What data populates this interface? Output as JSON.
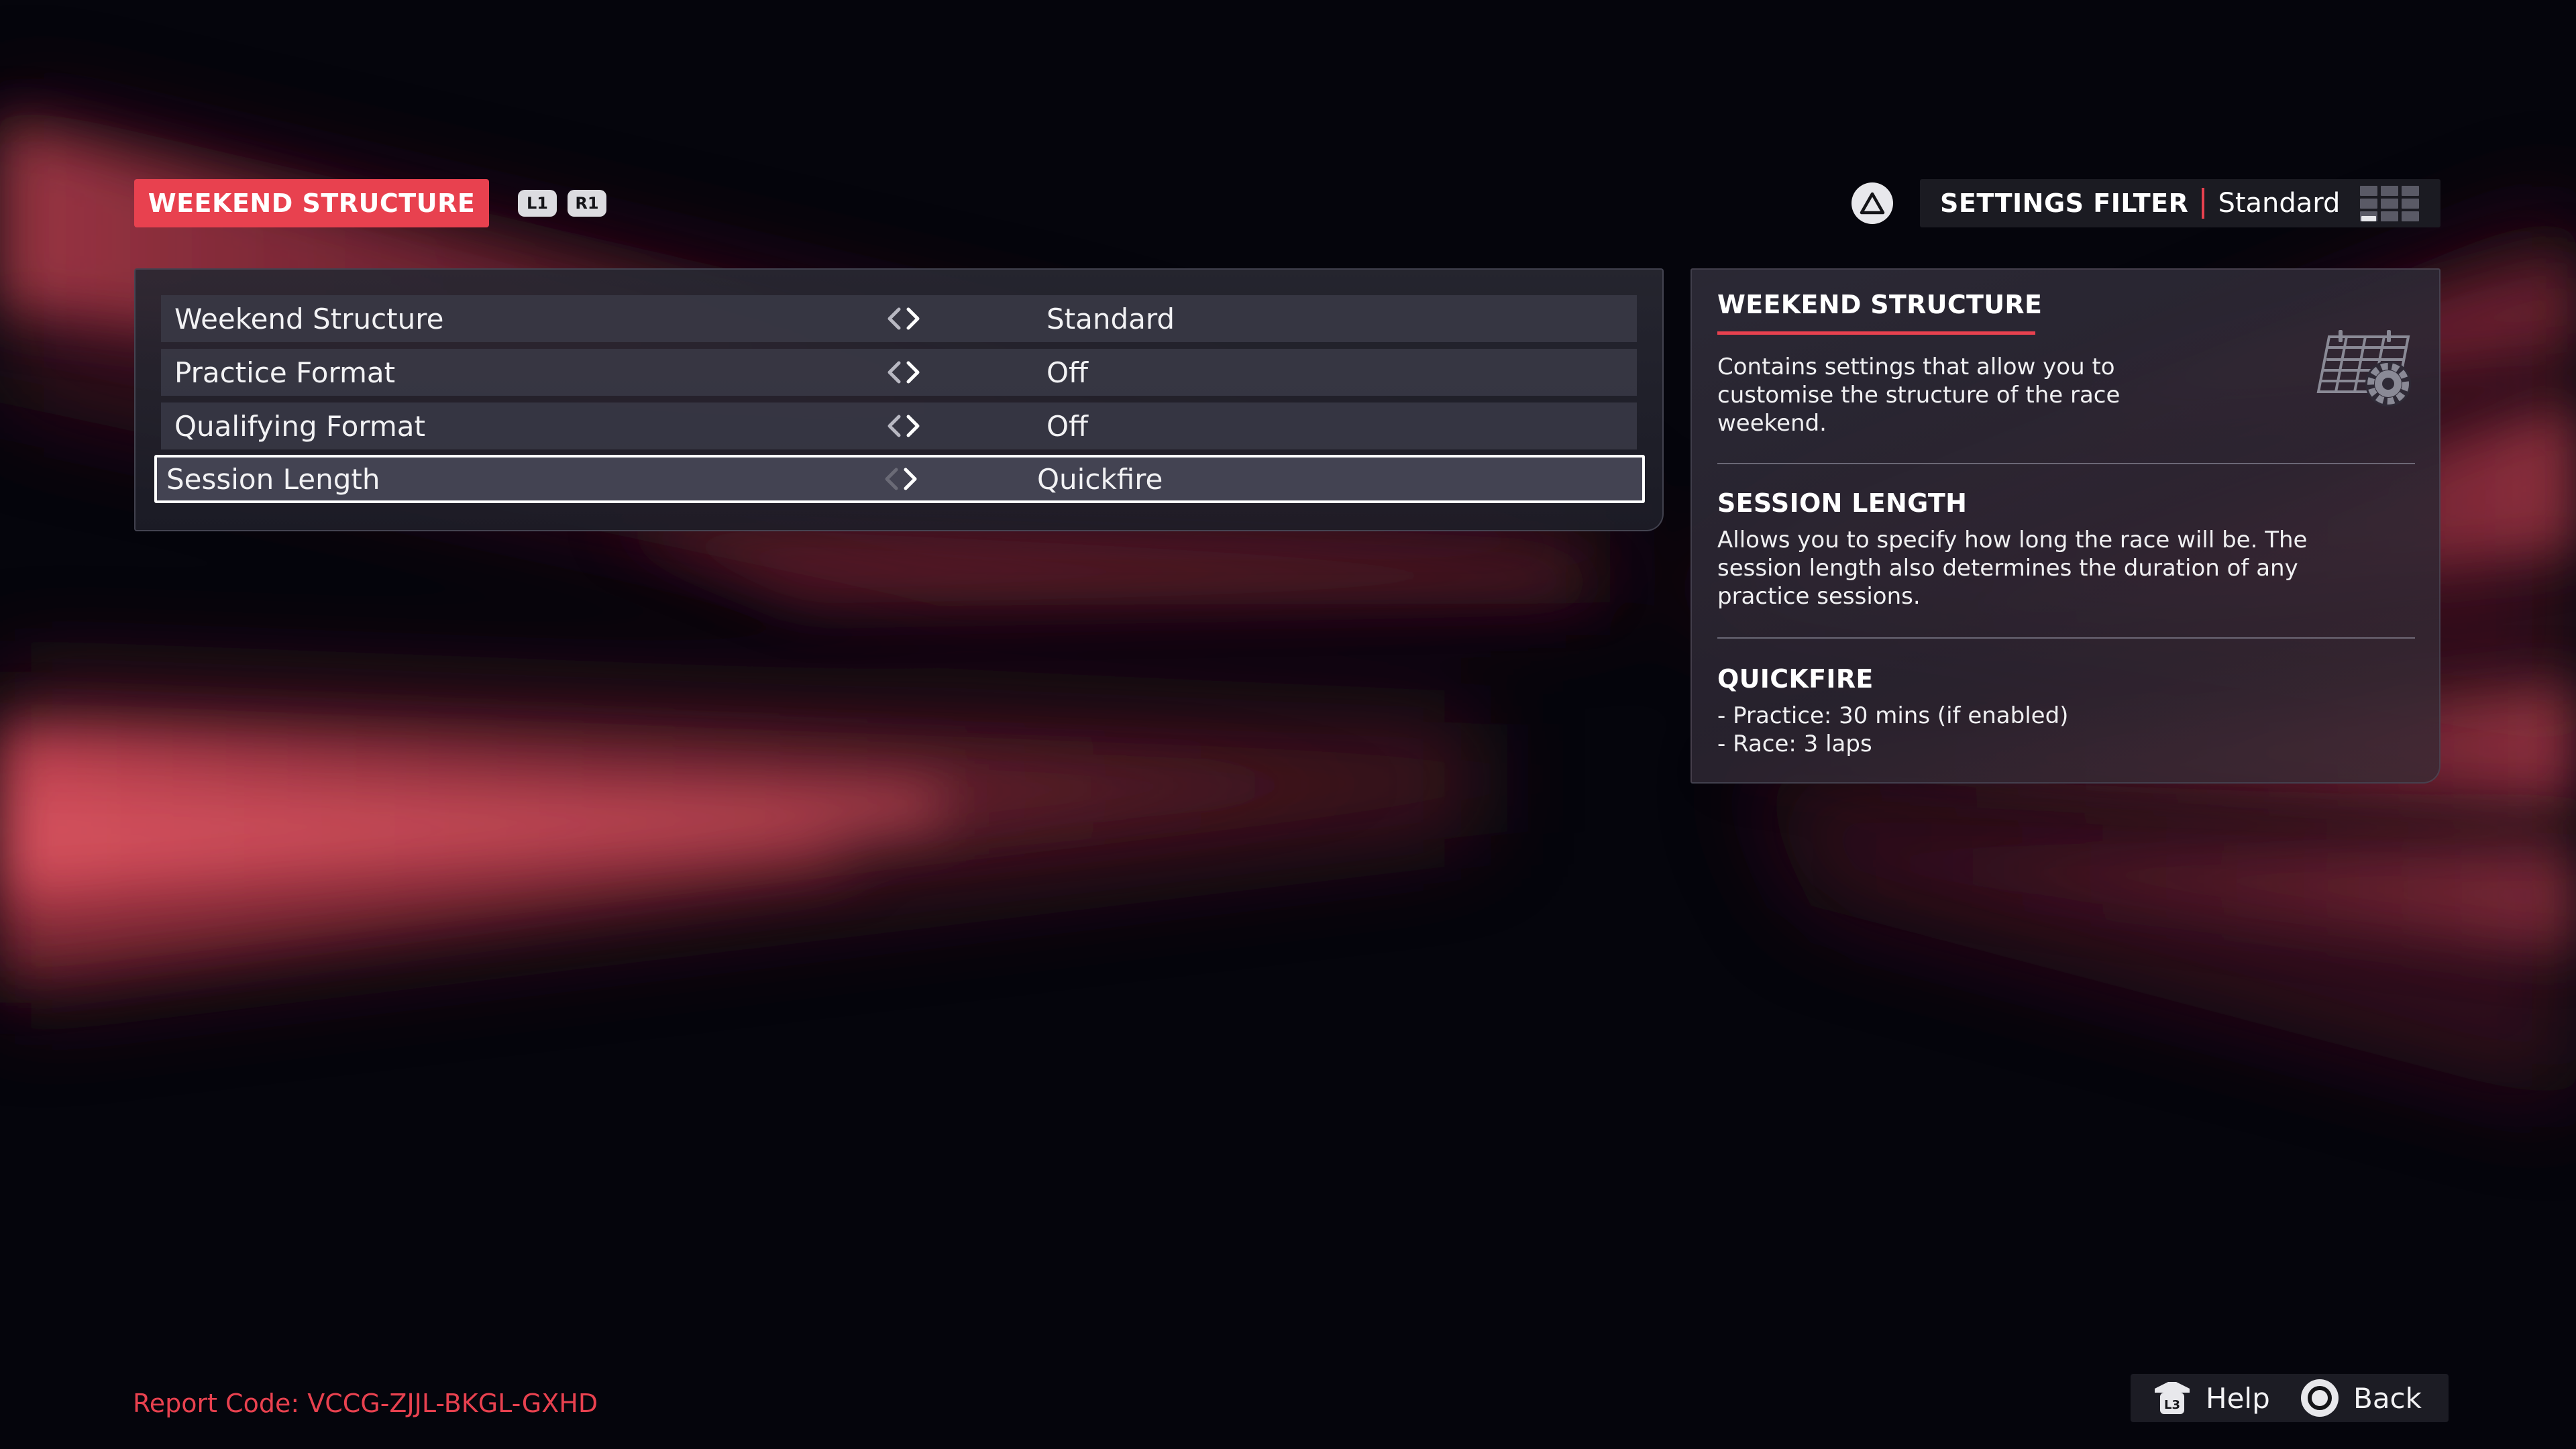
{
  "header": {
    "tab_label": "WEEKEND STRUCTURE",
    "bumper_left": "L1",
    "bumper_right": "R1"
  },
  "settings_filter": {
    "button_icon": "triangle-button-icon",
    "label": "SETTINGS FILTER",
    "value": "Standard",
    "icon": "grid-layout-icon"
  },
  "options": [
    {
      "label": "Weekend Structure",
      "value": "Standard",
      "selected": false
    },
    {
      "label": "Practice Format",
      "value": "Off",
      "selected": false
    },
    {
      "label": "Qualifying Format",
      "value": "Off",
      "selected": false
    },
    {
      "label": "Session Length",
      "value": "Quickfire",
      "selected": true
    }
  ],
  "info": {
    "sections": [
      {
        "title": "WEEKEND STRUCTURE",
        "lines": [
          "Contains settings that allow you to",
          "customise the structure of the race",
          "weekend."
        ]
      },
      {
        "title": "SESSION LENGTH",
        "lines": [
          "Allows you to specify how long the race will be. The",
          "session length also determines the duration of any",
          "practice sessions."
        ]
      },
      {
        "title": "QUICKFIRE",
        "lines": [
          "- Practice: 30 mins (if enabled)",
          "- Race: 3 laps"
        ]
      }
    ],
    "icon": "calendar-settings-icon"
  },
  "footer": {
    "report_code": "Report Code: VCCG-ZJJL-BKGL-GXHD",
    "help_label": "Help",
    "back_label": "Back"
  },
  "colors": {
    "accent": "#e8414f",
    "background": "#05050c",
    "panel": "#2e2e3a"
  }
}
